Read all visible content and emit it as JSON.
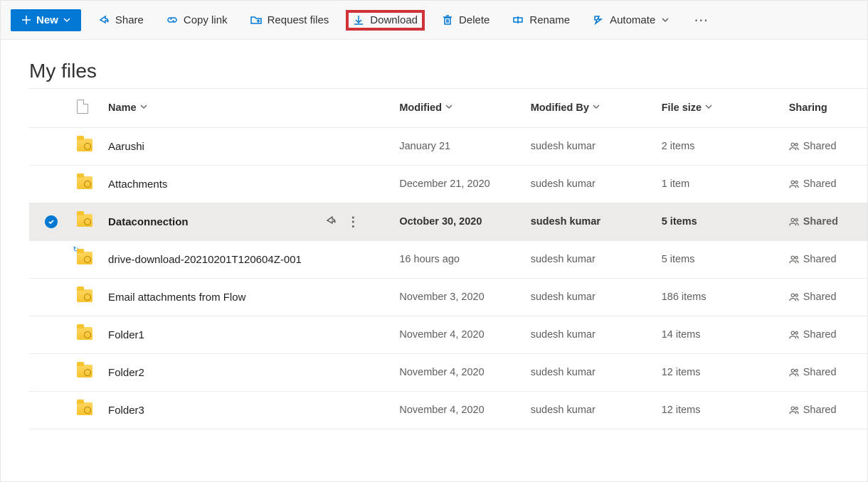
{
  "toolbar": {
    "new": "New",
    "share": "Share",
    "copy_link": "Copy link",
    "request_files": "Request files",
    "download": "Download",
    "delete": "Delete",
    "rename": "Rename",
    "automate": "Automate"
  },
  "page_title": "My files",
  "columns": {
    "name": "Name",
    "modified": "Modified",
    "modified_by": "Modified By",
    "file_size": "File size",
    "sharing": "Sharing"
  },
  "sharing_label": "Shared",
  "rows": [
    {
      "name": "Aarushi",
      "modified": "January 21",
      "modified_by": "sudesh kumar",
      "size": "2 items",
      "selected": false,
      "sync": false
    },
    {
      "name": "Attachments",
      "modified": "December 21, 2020",
      "modified_by": "sudesh kumar",
      "size": "1 item",
      "selected": false,
      "sync": false
    },
    {
      "name": "Dataconnection",
      "modified": "October 30, 2020",
      "modified_by": "sudesh kumar",
      "size": "5 items",
      "selected": true,
      "sync": false
    },
    {
      "name": "drive-download-20210201T120604Z-001",
      "modified": "16 hours ago",
      "modified_by": "sudesh kumar",
      "size": "5 items",
      "selected": false,
      "sync": true
    },
    {
      "name": "Email attachments from Flow",
      "modified": "November 3, 2020",
      "modified_by": "sudesh kumar",
      "size": "186 items",
      "selected": false,
      "sync": false
    },
    {
      "name": "Folder1",
      "modified": "November 4, 2020",
      "modified_by": "sudesh kumar",
      "size": "14 items",
      "selected": false,
      "sync": false
    },
    {
      "name": "Folder2",
      "modified": "November 4, 2020",
      "modified_by": "sudesh kumar",
      "size": "12 items",
      "selected": false,
      "sync": false
    },
    {
      "name": "Folder3",
      "modified": "November 4, 2020",
      "modified_by": "sudesh kumar",
      "size": "12 items",
      "selected": false,
      "sync": false
    }
  ]
}
